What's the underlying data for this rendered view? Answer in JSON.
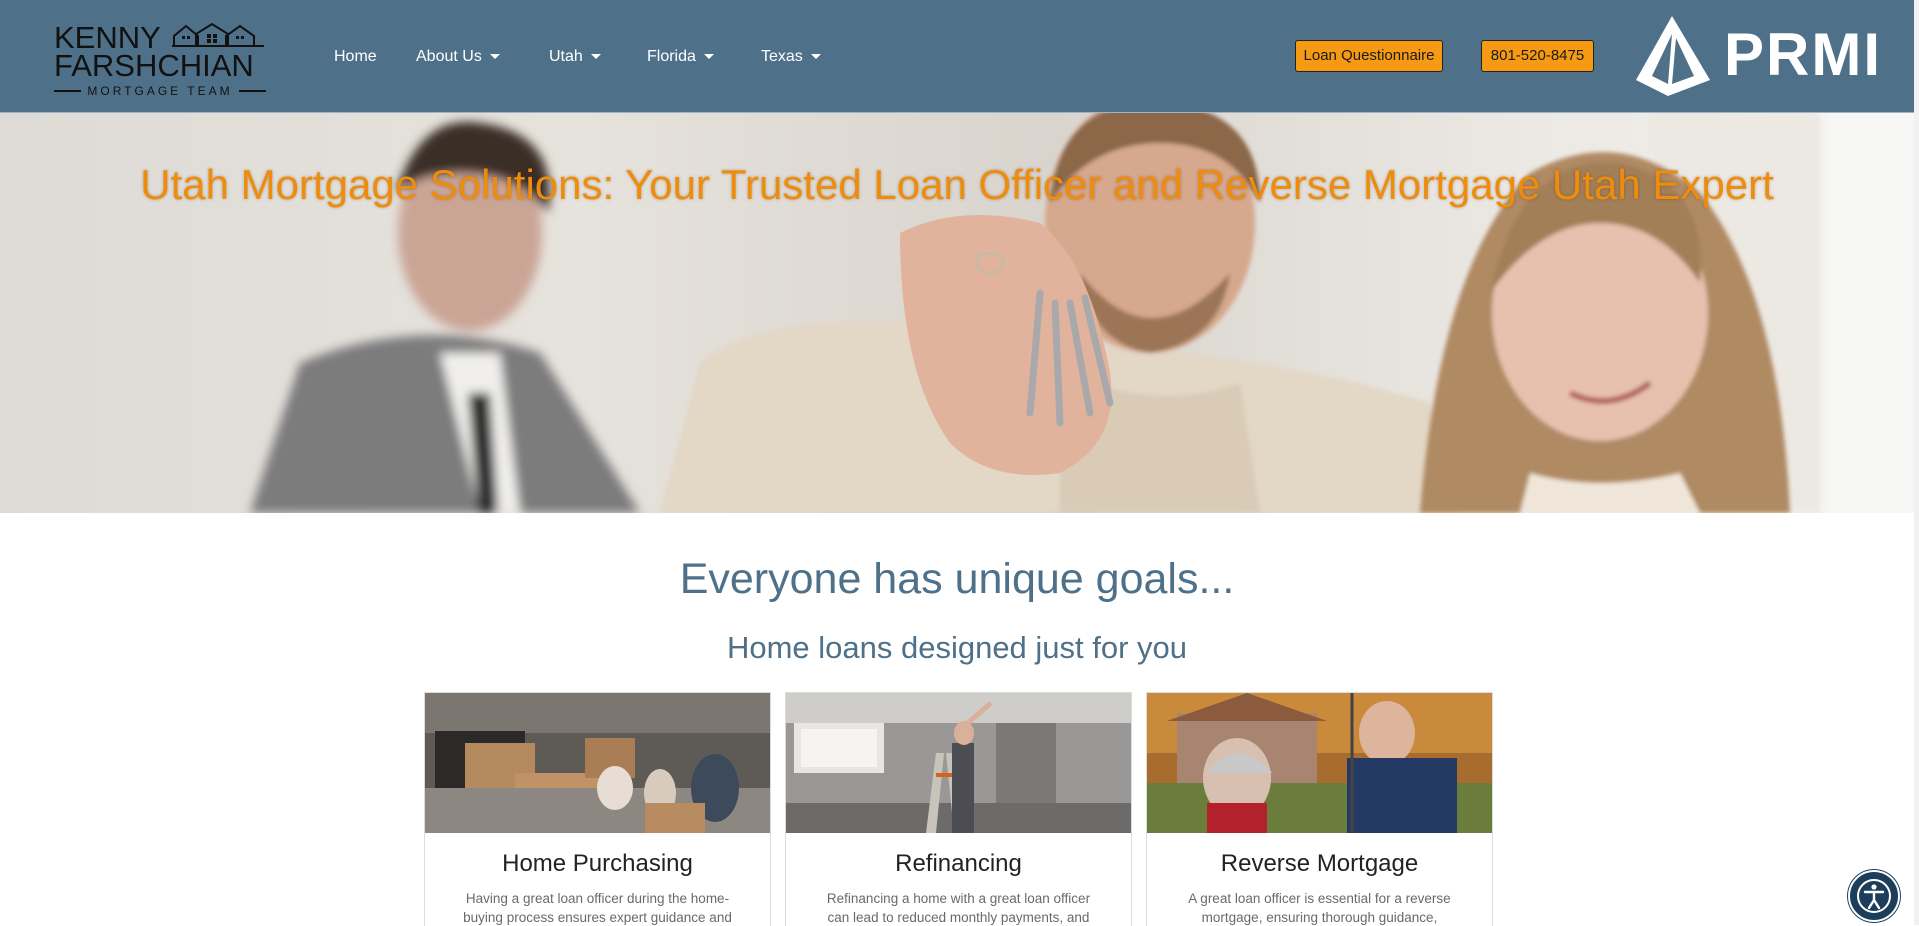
{
  "header": {
    "logo": {
      "line1": "KENNY",
      "line2": "FARSHCHIAN",
      "tagline": "MORTGAGE TEAM"
    },
    "nav": [
      {
        "label": "Home",
        "has_dropdown": false
      },
      {
        "label": "About Us",
        "has_dropdown": true
      },
      {
        "label": "Utah",
        "has_dropdown": true
      },
      {
        "label": "Florida",
        "has_dropdown": true
      },
      {
        "label": "Texas",
        "has_dropdown": true
      }
    ],
    "questionnaire_label": "Loan Questionnaire",
    "phone_label": "801-520-8475",
    "partner_logo": "PRMI",
    "colors": {
      "bar": "#4e7189",
      "button": "#f59a12"
    }
  },
  "hero": {
    "title": "Utah Mortgage Solutions: Your Trusted Loan Officer and Reverse Mortgage Utah Expert",
    "title_color": "#f08c0c"
  },
  "goals": {
    "title": "Everyone has unique goals...",
    "subtitle": "Home loans designed just for you"
  },
  "cards": [
    {
      "title": "Home Purchasing",
      "text": "Having a great loan officer during the home-buying process ensures expert guidance and"
    },
    {
      "title": "Refinancing",
      "text": "Refinancing a home with a great loan officer can lead to reduced monthly payments, and potential"
    },
    {
      "title": "Reverse Mortgage",
      "text": "A great loan officer is essential for a reverse mortgage, ensuring thorough guidance,"
    }
  ],
  "accessibility_icon": "accessibility-icon"
}
